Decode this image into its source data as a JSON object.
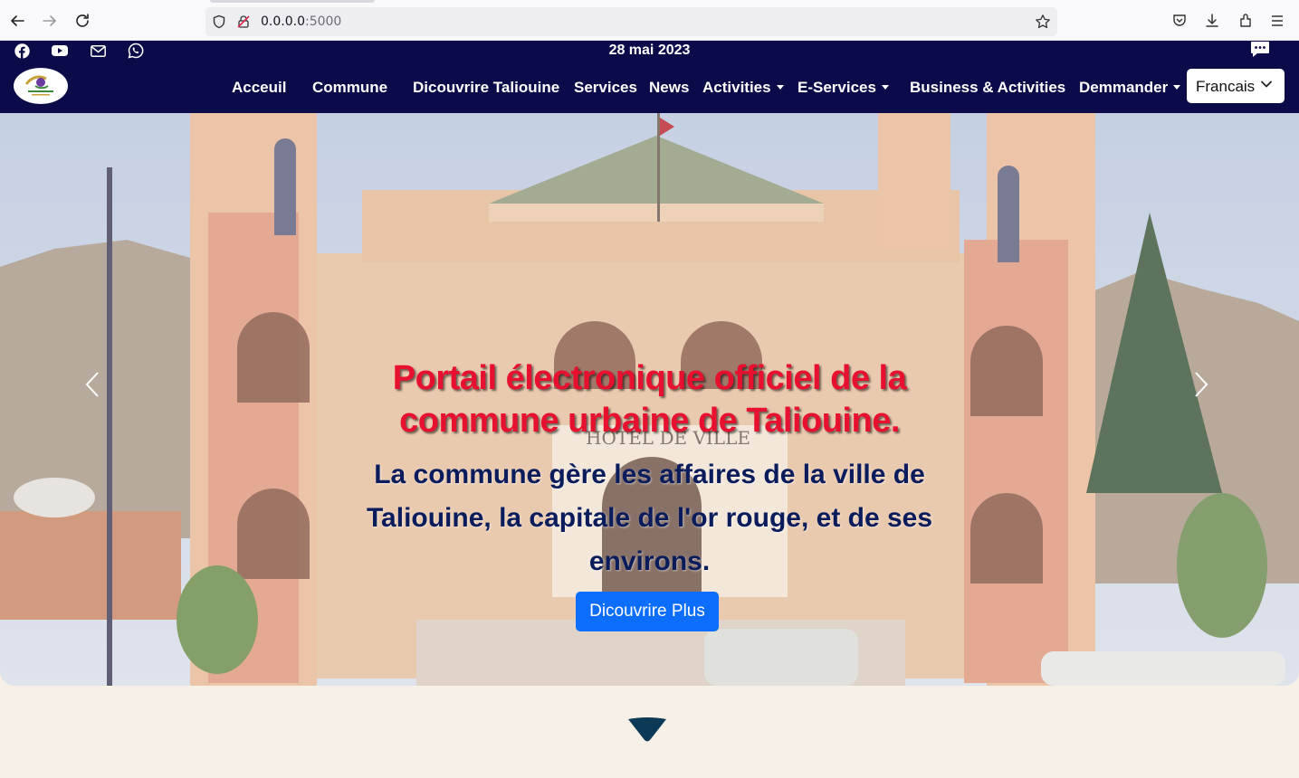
{
  "browser": {
    "url_host": "0.0.0.0",
    "url_port": ":5000"
  },
  "header": {
    "date": "28 mai 2023",
    "social_icons": [
      "facebook-icon",
      "youtube-icon",
      "mail-icon",
      "whatsapp-icon"
    ],
    "nav": [
      {
        "label": "Acceuil",
        "dropdown": false
      },
      {
        "label": "Commune",
        "dropdown": false
      },
      {
        "label": "Dicouvrire Taliouine",
        "dropdown": false
      },
      {
        "label": "Services",
        "dropdown": false
      },
      {
        "label": "News",
        "dropdown": false
      },
      {
        "label": "Activities",
        "dropdown": true
      },
      {
        "label": "E-Services",
        "dropdown": true
      },
      {
        "label": "Business & Activities",
        "dropdown": false
      },
      {
        "label": "Demmander",
        "dropdown": true
      }
    ],
    "language": "Francais"
  },
  "hero": {
    "title": "Portail électronique officiel de la commune urbaine de Taliouine.",
    "subtitle": "La commune gère les affaires de la ville de Taliouine, la capitale de l'or rouge, et de ses environs.",
    "button_label": "Dicouvrire Plus",
    "building_sign": "HOTEL DE VILLE"
  },
  "colors": {
    "header_bg": "#0b0b4a",
    "title_red": "#e8102f",
    "subtitle_navy": "#0b1c5c",
    "button_blue": "#0d6efd",
    "page_bg": "#f6f0e6",
    "arrow": "#0c3a56"
  }
}
